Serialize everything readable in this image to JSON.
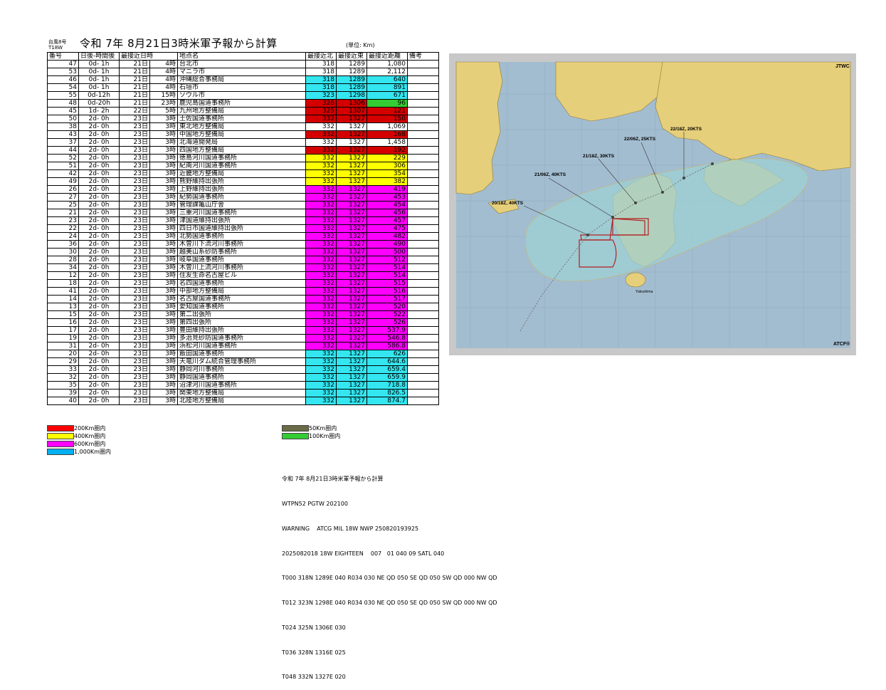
{
  "header": {
    "small_line1": "台風8号",
    "small_line2": "T18W",
    "title": "令和 7年 8月21日3時米軍予報から計算",
    "unit": "(単位: Km)"
  },
  "table": {
    "columns": [
      "番号",
      "日後-時間後",
      "最接近日時",
      "地点名",
      "最接近北",
      "最接近東",
      "最接近距離",
      "備考"
    ],
    "rows": [
      {
        "id": "47",
        "after": "0d- 1h",
        "day": "21日",
        "hour": "4時",
        "name": "台北市",
        "lat": "318",
        "lon": "1289",
        "dist": "1,080",
        "color": "#ffffff"
      },
      {
        "id": "53",
        "after": "0d- 1h",
        "day": "21日",
        "hour": "4時",
        "name": "マニラ市",
        "lat": "318",
        "lon": "1289",
        "dist": "2,112",
        "color": "#ffffff"
      },
      {
        "id": "46",
        "after": "0d- 1h",
        "day": "21日",
        "hour": "4時",
        "name": "沖縄総合事務局",
        "lat": "318",
        "lon": "1289",
        "dist": "640",
        "color": "#33e6f0"
      },
      {
        "id": "54",
        "after": "0d- 1h",
        "day": "21日",
        "hour": "4時",
        "name": "石垣市",
        "lat": "318",
        "lon": "1289",
        "dist": "891",
        "color": "#33e6f0"
      },
      {
        "id": "55",
        "after": "0d-12h",
        "day": "21日",
        "hour": "15時",
        "name": "ソウル市",
        "lat": "323",
        "lon": "1298",
        "dist": "671",
        "color": "#33e6f0"
      },
      {
        "id": "48",
        "after": "0d-20h",
        "day": "21日",
        "hour": "23時",
        "name": "鹿児島国道事務所",
        "lat": "326",
        "lon": "1306",
        "dist": "96",
        "color": "#d40000",
        "dcolor": "#33cc33"
      },
      {
        "id": "45",
        "after": "1d- 2h",
        "day": "22日",
        "hour": "5時",
        "name": "九州地方整備局",
        "lat": "325",
        "lon": "1307",
        "dist": "121",
        "color": "#d40000"
      },
      {
        "id": "50",
        "after": "2d- 0h",
        "day": "23日",
        "hour": "3時",
        "name": "土佐国道事務所",
        "lat": "332",
        "lon": "1327",
        "dist": "150",
        "color": "#d40000"
      },
      {
        "id": "38",
        "after": "2d- 0h",
        "day": "23日",
        "hour": "3時",
        "name": "東北地方整備局",
        "lat": "332",
        "lon": "1327",
        "dist": "1,069",
        "color": "#ffffff"
      },
      {
        "id": "43",
        "after": "2d- 0h",
        "day": "23日",
        "hour": "3時",
        "name": "中国地方整備局",
        "lat": "332",
        "lon": "1327",
        "dist": "168",
        "color": "#d40000"
      },
      {
        "id": "37",
        "after": "2d- 0h",
        "day": "23日",
        "hour": "3時",
        "name": "北海道開発局",
        "lat": "332",
        "lon": "1327",
        "dist": "1,458",
        "color": "#ffffff"
      },
      {
        "id": "44",
        "after": "2d- 0h",
        "day": "23日",
        "hour": "3時",
        "name": "四国地方整備局",
        "lat": "332",
        "lon": "1327",
        "dist": "192",
        "color": "#d40000"
      },
      {
        "id": "52",
        "after": "2d- 0h",
        "day": "23日",
        "hour": "3時",
        "name": "徳島河川国道事務所",
        "lat": "332",
        "lon": "1327",
        "dist": "229",
        "color": "#ffff00"
      },
      {
        "id": "51",
        "after": "2d- 0h",
        "day": "23日",
        "hour": "3時",
        "name": "紀南河川国道事務所",
        "lat": "332",
        "lon": "1327",
        "dist": "306",
        "color": "#ffff00"
      },
      {
        "id": "42",
        "after": "2d- 0h",
        "day": "23日",
        "hour": "3時",
        "name": "近畿地方整備局",
        "lat": "332",
        "lon": "1327",
        "dist": "354",
        "color": "#ffff00"
      },
      {
        "id": "49",
        "after": "2d- 0h",
        "day": "23日",
        "hour": "3時",
        "name": "熊野維持出張所",
        "lat": "332",
        "lon": "1327",
        "dist": "382",
        "color": "#ffff00"
      },
      {
        "id": "26",
        "after": "2d- 0h",
        "day": "23日",
        "hour": "3時",
        "name": "上野維持出張所",
        "lat": "332",
        "lon": "1327",
        "dist": "419",
        "color": "#ff00ff"
      },
      {
        "id": "27",
        "after": "2d- 0h",
        "day": "23日",
        "hour": "3時",
        "name": "紀勢国道事務所",
        "lat": "332",
        "lon": "1327",
        "dist": "453",
        "color": "#ff00ff"
      },
      {
        "id": "25",
        "after": "2d- 0h",
        "day": "23日",
        "hour": "3時",
        "name": "管理課亀山庁舎",
        "lat": "332",
        "lon": "1327",
        "dist": "454",
        "color": "#ff00ff"
      },
      {
        "id": "21",
        "after": "2d- 0h",
        "day": "23日",
        "hour": "3時",
        "name": "三重河川国道事務所",
        "lat": "332",
        "lon": "1327",
        "dist": "456",
        "color": "#ff00ff"
      },
      {
        "id": "23",
        "after": "2d- 0h",
        "day": "23日",
        "hour": "3時",
        "name": "津国道維持出張所",
        "lat": "332",
        "lon": "1327",
        "dist": "457",
        "color": "#ff00ff"
      },
      {
        "id": "22",
        "after": "2d- 0h",
        "day": "23日",
        "hour": "3時",
        "name": "四日市国道維持出張所",
        "lat": "332",
        "lon": "1327",
        "dist": "475",
        "color": "#ff00ff"
      },
      {
        "id": "24",
        "after": "2d- 0h",
        "day": "23日",
        "hour": "3時",
        "name": "北勢国道事務所",
        "lat": "332",
        "lon": "1327",
        "dist": "482",
        "color": "#ff00ff"
      },
      {
        "id": "36",
        "after": "2d- 0h",
        "day": "23日",
        "hour": "3時",
        "name": "木曽川下流河川事務所",
        "lat": "332",
        "lon": "1327",
        "dist": "490",
        "color": "#ff00ff"
      },
      {
        "id": "30",
        "after": "2d- 0h",
        "day": "23日",
        "hour": "3時",
        "name": "越美山系砂防事務所",
        "lat": "332",
        "lon": "1327",
        "dist": "500",
        "color": "#ff00ff"
      },
      {
        "id": "28",
        "after": "2d- 0h",
        "day": "23日",
        "hour": "3時",
        "name": "岐阜国道事務所",
        "lat": "332",
        "lon": "1327",
        "dist": "512",
        "color": "#ff00ff"
      },
      {
        "id": "34",
        "after": "2d- 0h",
        "day": "23日",
        "hour": "3時",
        "name": "木曽川上流河川事務所",
        "lat": "332",
        "lon": "1327",
        "dist": "514",
        "color": "#ff00ff"
      },
      {
        "id": "12",
        "after": "2d- 0h",
        "day": "23日",
        "hour": "3時",
        "name": "住友生命名古屋ビル",
        "lat": "332",
        "lon": "1327",
        "dist": "514",
        "color": "#ff00ff"
      },
      {
        "id": "18",
        "after": "2d- 0h",
        "day": "23日",
        "hour": "3時",
        "name": "名四国道事務所",
        "lat": "332",
        "lon": "1327",
        "dist": "515",
        "color": "#ff00ff"
      },
      {
        "id": "41",
        "after": "2d- 0h",
        "day": "23日",
        "hour": "3時",
        "name": "中部地方整備局",
        "lat": "332",
        "lon": "1327",
        "dist": "516",
        "color": "#ff00ff"
      },
      {
        "id": "14",
        "after": "2d- 0h",
        "day": "23日",
        "hour": "3時",
        "name": "名古屋国道事務所",
        "lat": "332",
        "lon": "1327",
        "dist": "517",
        "color": "#ff00ff"
      },
      {
        "id": "13",
        "after": "2d- 0h",
        "day": "23日",
        "hour": "3時",
        "name": "愛知国道事務所",
        "lat": "332",
        "lon": "1327",
        "dist": "520",
        "color": "#ff00ff"
      },
      {
        "id": "15",
        "after": "2d- 0h",
        "day": "23日",
        "hour": "3時",
        "name": "第二出張所",
        "lat": "332",
        "lon": "1327",
        "dist": "522",
        "color": "#ff00ff"
      },
      {
        "id": "16",
        "after": "2d- 0h",
        "day": "23日",
        "hour": "3時",
        "name": "第四出張所",
        "lat": "332",
        "lon": "1327",
        "dist": "526",
        "color": "#ff00ff"
      },
      {
        "id": "17",
        "after": "2d- 0h",
        "day": "23日",
        "hour": "3時",
        "name": "豊田維持出張所",
        "lat": "332",
        "lon": "1327",
        "dist": "537.9",
        "color": "#ff00ff"
      },
      {
        "id": "19",
        "after": "2d- 0h",
        "day": "23日",
        "hour": "3時",
        "name": "多治見砂防国道事務所",
        "lat": "332",
        "lon": "1327",
        "dist": "546.8",
        "color": "#ff00ff"
      },
      {
        "id": "31",
        "after": "2d- 0h",
        "day": "23日",
        "hour": "3時",
        "name": "浜松河川国道事務所",
        "lat": "332",
        "lon": "1327",
        "dist": "586.8",
        "color": "#ff00ff"
      },
      {
        "id": "20",
        "after": "2d- 0h",
        "day": "23日",
        "hour": "3時",
        "name": "飯田国道事務所",
        "lat": "332",
        "lon": "1327",
        "dist": "626",
        "color": "#33e6f0"
      },
      {
        "id": "29",
        "after": "2d- 0h",
        "day": "23日",
        "hour": "3時",
        "name": "天竜川ダム統合管理事務所",
        "lat": "332",
        "lon": "1327",
        "dist": "644.6",
        "color": "#33e6f0"
      },
      {
        "id": "33",
        "after": "2d- 0h",
        "day": "23日",
        "hour": "3時",
        "name": "静岡河川事務所",
        "lat": "332",
        "lon": "1327",
        "dist": "659.4",
        "color": "#33e6f0"
      },
      {
        "id": "32",
        "after": "2d- 0h",
        "day": "23日",
        "hour": "3時",
        "name": "静岡国道事務所",
        "lat": "332",
        "lon": "1327",
        "dist": "659.9",
        "color": "#33e6f0"
      },
      {
        "id": "35",
        "after": "2d- 0h",
        "day": "23日",
        "hour": "3時",
        "name": "沼津河川国道事務所",
        "lat": "332",
        "lon": "1327",
        "dist": "718.8",
        "color": "#33e6f0"
      },
      {
        "id": "39",
        "after": "2d- 0h",
        "day": "23日",
        "hour": "3時",
        "name": "関東地方整備局",
        "lat": "332",
        "lon": "1327",
        "dist": "826.5",
        "color": "#33e6f0"
      },
      {
        "id": "40",
        "after": "2d- 0h",
        "day": "23日",
        "hour": "3時",
        "name": "北陸地方整備局",
        "lat": "332",
        "lon": "1327",
        "dist": "874.7",
        "color": "#33e6f0"
      }
    ]
  },
  "legend": [
    {
      "label": "200Km圏内",
      "color": "#ff0000"
    },
    {
      "label": "400Km圏内",
      "color": "#ffff00"
    },
    {
      "label": "600Km圏内",
      "color": "#ff00ff"
    },
    {
      "label": "1,000Km圏内",
      "color": "#00b0f0"
    },
    {
      "label": "50Km圏内",
      "color": "#6b6b47"
    },
    {
      "label": "100Km圏内",
      "color": "#33cc33"
    }
  ],
  "notes": [
    "令和 7年 8月21日3時米軍予報から計算",
    "WTPN52 PGTW 202100",
    "WARNING    ATCG MIL 18W NWP 250820193925",
    "2025082018 18W EIGHTEEN    007   01 040 09 SATL 040",
    "T000 318N 1289E 040 R034 030 NE QD 050 SE QD 050 SW QD 000 NW QD",
    "T012 323N 1298E 040 R034 030 NE QD 050 SE QD 050 SW QD 000 NW QD",
    "T024 325N 1306E 030",
    "T036 328N 1316E 025",
    "T048 332N 1327E 020"
  ],
  "map": {
    "corner_label": "JTWC",
    "footer_label": "ATCF®",
    "forecast_labels": [
      "20/18Z, 40KTS",
      "21/06Z, 40KTS",
      "21/18Z, 30KTS",
      "22/06Z, 25KTS",
      "22/18Z, 20KTS"
    ],
    "place_labels": [
      "Yakushima"
    ],
    "colors": {
      "sea": "#a3bdd0",
      "land": "#e6cf7a",
      "danger_area": "#9ed0d4",
      "wind_radius": "#b22222"
    }
  }
}
